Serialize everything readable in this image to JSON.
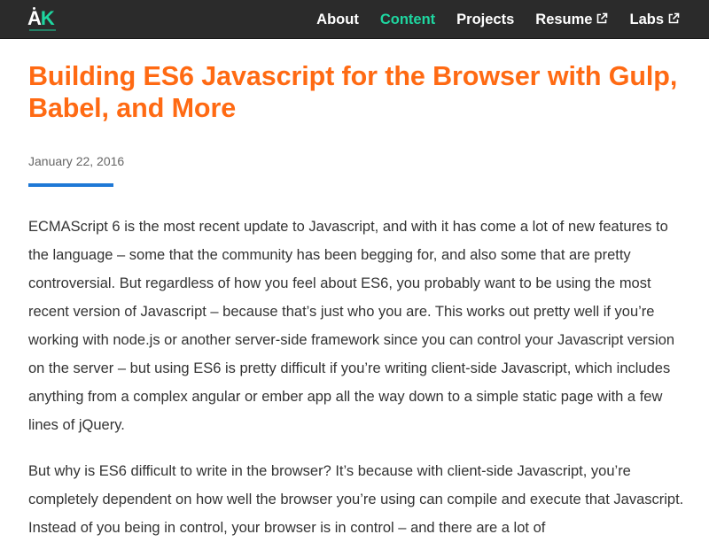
{
  "nav": {
    "logo": {
      "letter_a": "A",
      "letter_k": "K"
    },
    "links": [
      {
        "label": "About",
        "active": false,
        "external": false
      },
      {
        "label": "Content",
        "active": true,
        "external": false
      },
      {
        "label": "Projects",
        "active": false,
        "external": false
      },
      {
        "label": "Resume",
        "active": false,
        "external": true,
        "icon": "external-link-icon"
      },
      {
        "label": "Labs",
        "active": false,
        "external": true,
        "icon": "external-link-icon"
      }
    ]
  },
  "article": {
    "title": "Building ES6 Javascript for the Browser with Gulp, Babel, and More",
    "date": "January 22, 2016",
    "paragraphs": [
      "ECMAScript 6 is the most recent update to Javascript, and with it has come a lot of new features to the language – some that the community has been begging for, and also some that are pretty controversial. But regardless of how you feel about ES6, you probably want to be using the most recent version of Javascript – because that’s just who you are. This works out pretty well if you’re working with node.js or another server-side framework since you can control your Javascript version on the server – but using ES6 is pretty difficult if you’re writing client-side Javascript, which includes anything from a complex angular or ember app all the way down to a simple static page with a few lines of jQuery.",
      "But why is ES6 difficult to write in the browser? It’s because with client-side Javascript, you’re completely dependent on how well the browser you’re using can compile and execute that Javascript. Instead of you being in control, your browser is in control – and there are a lot of"
    ]
  },
  "colors": {
    "navbar_bg": "#2b2b2b",
    "accent_green": "#1ed6a0",
    "title_orange": "#ff6a13",
    "divider_blue": "#1e78d6",
    "body_text": "#333333",
    "date_text": "#666666"
  }
}
